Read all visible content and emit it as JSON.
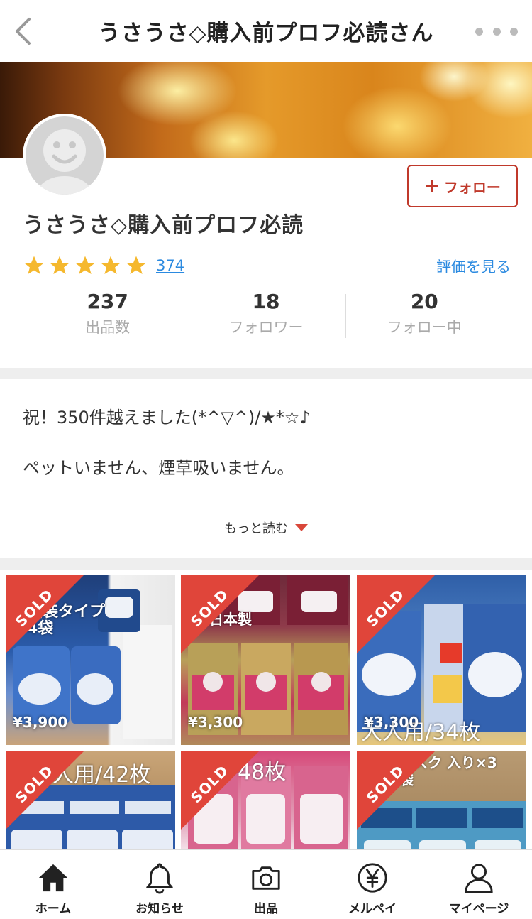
{
  "header": {
    "title": "うさうさ◇購入前プロフ必読さん",
    "back_icon": "chevron-left-icon",
    "more_icon": "more-dots-icon"
  },
  "profile": {
    "name": "うさうさ◇購入前プロフ必読",
    "follow_label": "フォロー",
    "rating_stars": 5,
    "rating_count": "374",
    "see_reviews_label": "評価を見る",
    "stats": [
      {
        "value": "237",
        "label": "出品数"
      },
      {
        "value": "18",
        "label": "フォロワー"
      },
      {
        "value": "20",
        "label": "フォロー中"
      }
    ]
  },
  "bio": {
    "lines": [
      "祝！350件越えました(*^▽^)/★*☆♪",
      "ペットいません、煙草吸いません。"
    ],
    "more_label": "もっと読む"
  },
  "items": [
    {
      "status": "SOLD",
      "price": "¥3,900",
      "caption": "個装タイプ 4袋"
    },
    {
      "status": "SOLD",
      "price": "¥3,300",
      "caption": "日本製"
    },
    {
      "status": "SOLD",
      "price": "¥3,300",
      "caption": "大人用/34枚"
    },
    {
      "status": "SOLD",
      "price": "",
      "caption": "大人用/42枚"
    },
    {
      "status": "SOLD",
      "price": "",
      "caption": "48枚"
    },
    {
      "status": "SOLD",
      "price": "",
      "caption": "マスク 入り×3袋"
    }
  ],
  "tabbar": [
    {
      "label": "ホーム",
      "icon": "home-icon"
    },
    {
      "label": "お知らせ",
      "icon": "bell-icon"
    },
    {
      "label": "出品",
      "icon": "camera-icon"
    },
    {
      "label": "メルペイ",
      "icon": "yen-icon"
    },
    {
      "label": "マイページ",
      "icon": "person-icon"
    }
  ],
  "colors": {
    "accent": "#e0453a",
    "link": "#2b8ae0",
    "star": "#f5b82e"
  }
}
